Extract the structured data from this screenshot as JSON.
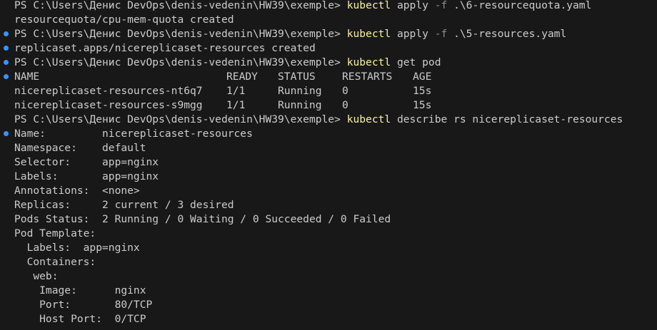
{
  "terminal": {
    "prompt": "PS C:\\Users\\Денис DevOps\\denis-vedenin\\HW39\\exemple>",
    "cmd1": {
      "cmd": "kubectl",
      "rest_a": " apply ",
      "flag": "-f",
      "rest_b": " .\\6-resourcequota.yaml"
    },
    "out1": "resourcequota/cpu-mem-quota created",
    "cmd2": {
      "cmd": "kubectl",
      "rest_a": " apply ",
      "flag": "-f",
      "rest_b": " .\\5-resources.yaml"
    },
    "out2": "replicaset.apps/nicereplicaset-resources created",
    "cmd3": {
      "cmd": "kubectl",
      "rest": " get pod"
    },
    "pods": {
      "headers": [
        "NAME",
        "READY",
        "STATUS",
        "RESTARTS",
        "AGE"
      ],
      "rows": [
        [
          "nicereplicaset-resources-nt6q7",
          "1/1",
          "Running",
          "0",
          "15s"
        ],
        [
          "nicereplicaset-resources-s9mgg",
          "1/1",
          "Running",
          "0",
          "15s"
        ]
      ]
    },
    "cmd4": {
      "cmd": "kubectl",
      "rest": " describe rs nicereplicaset-resources"
    },
    "describe": [
      "Name:         nicereplicaset-resources",
      "Namespace:    default",
      "Selector:     app=nginx",
      "Labels:       app=nginx",
      "Annotations:  <none>",
      "Replicas:     2 current / 3 desired",
      "Pods Status:  2 Running / 0 Waiting / 0 Succeeded / 0 Failed",
      "Pod Template:",
      "  Labels:  app=nginx",
      "  Containers:",
      "   web:",
      "    Image:      nginx",
      "    Port:       80/TCP",
      "    Host Port:  0/TCP"
    ]
  }
}
